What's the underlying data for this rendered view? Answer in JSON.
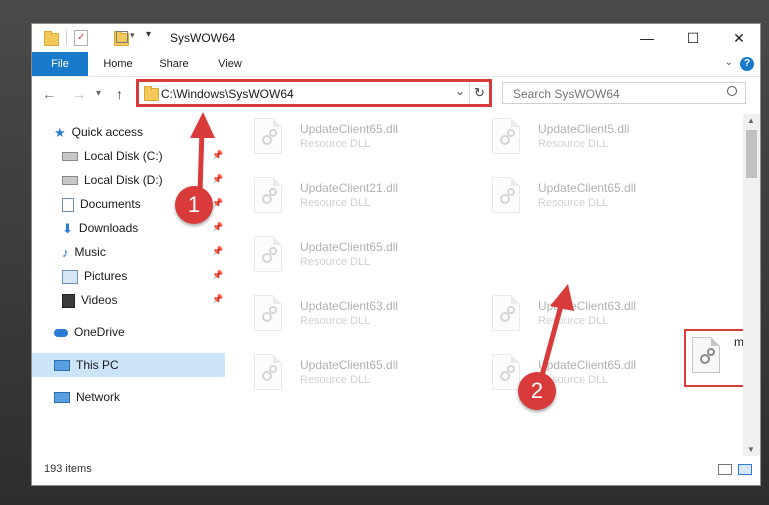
{
  "window": {
    "title": "SysWOW64",
    "minimize": "—",
    "maximize": "☐",
    "close": "✕"
  },
  "ribbon": {
    "tabs": [
      "File",
      "Home",
      "Share",
      "View"
    ],
    "help": "?"
  },
  "nav": {
    "back": "←",
    "forward": "→",
    "recent": "▾",
    "up": "↑",
    "address": "C:\\Windows\\SysWOW64",
    "refresh": "↻",
    "dropdown": "⌄",
    "search_placeholder": "Search SysWOW64"
  },
  "sidebar": {
    "items": [
      {
        "label": "Quick access",
        "icon": "star-icon"
      },
      {
        "label": "Local Disk (C:)",
        "icon": "drive-icon"
      },
      {
        "label": "Local Disk (D:)",
        "icon": "drive-icon"
      },
      {
        "label": "Documents",
        "icon": "documents-icon"
      },
      {
        "label": "Downloads",
        "icon": "downloads-icon"
      },
      {
        "label": "Music",
        "icon": "music-icon"
      },
      {
        "label": "Pictures",
        "icon": "pictures-icon"
      },
      {
        "label": "Videos",
        "icon": "videos-icon"
      },
      {
        "label": "OneDrive",
        "icon": "cloud-icon"
      },
      {
        "label": "This PC",
        "icon": "computer-icon"
      },
      {
        "label": "Network",
        "icon": "network-icon"
      }
    ]
  },
  "files": [
    {
      "name": "UpdateClient65.dll",
      "type": "Resource DLL"
    },
    {
      "name": "UpdateClient5.dll",
      "type": "Resource DLL"
    },
    {
      "name": "UpdateClient21.dll",
      "type": "Resource DLL"
    },
    {
      "name": "UpdateClient65.dll",
      "type": "Resource DLL"
    },
    {
      "name": "UpdateClient65.dll",
      "type": "Resource DLL"
    },
    {
      "name": "matlablink.dll",
      "type": ""
    },
    {
      "name": "UpdateClient63.dll",
      "type": "Resource DLL"
    },
    {
      "name": "UpdateClient63.dll",
      "type": "Resource DLL"
    },
    {
      "name": "UpdateClient65.dll",
      "type": "Resource DLL"
    },
    {
      "name": "UpdateClient65.dll",
      "type": "Resource DLL"
    }
  ],
  "status": {
    "items_count": "193 items"
  },
  "markers": [
    "1",
    "2"
  ],
  "colors": {
    "accent": "#1979ca",
    "highlight": "#d93a3a",
    "selection": "#cce4f7"
  }
}
